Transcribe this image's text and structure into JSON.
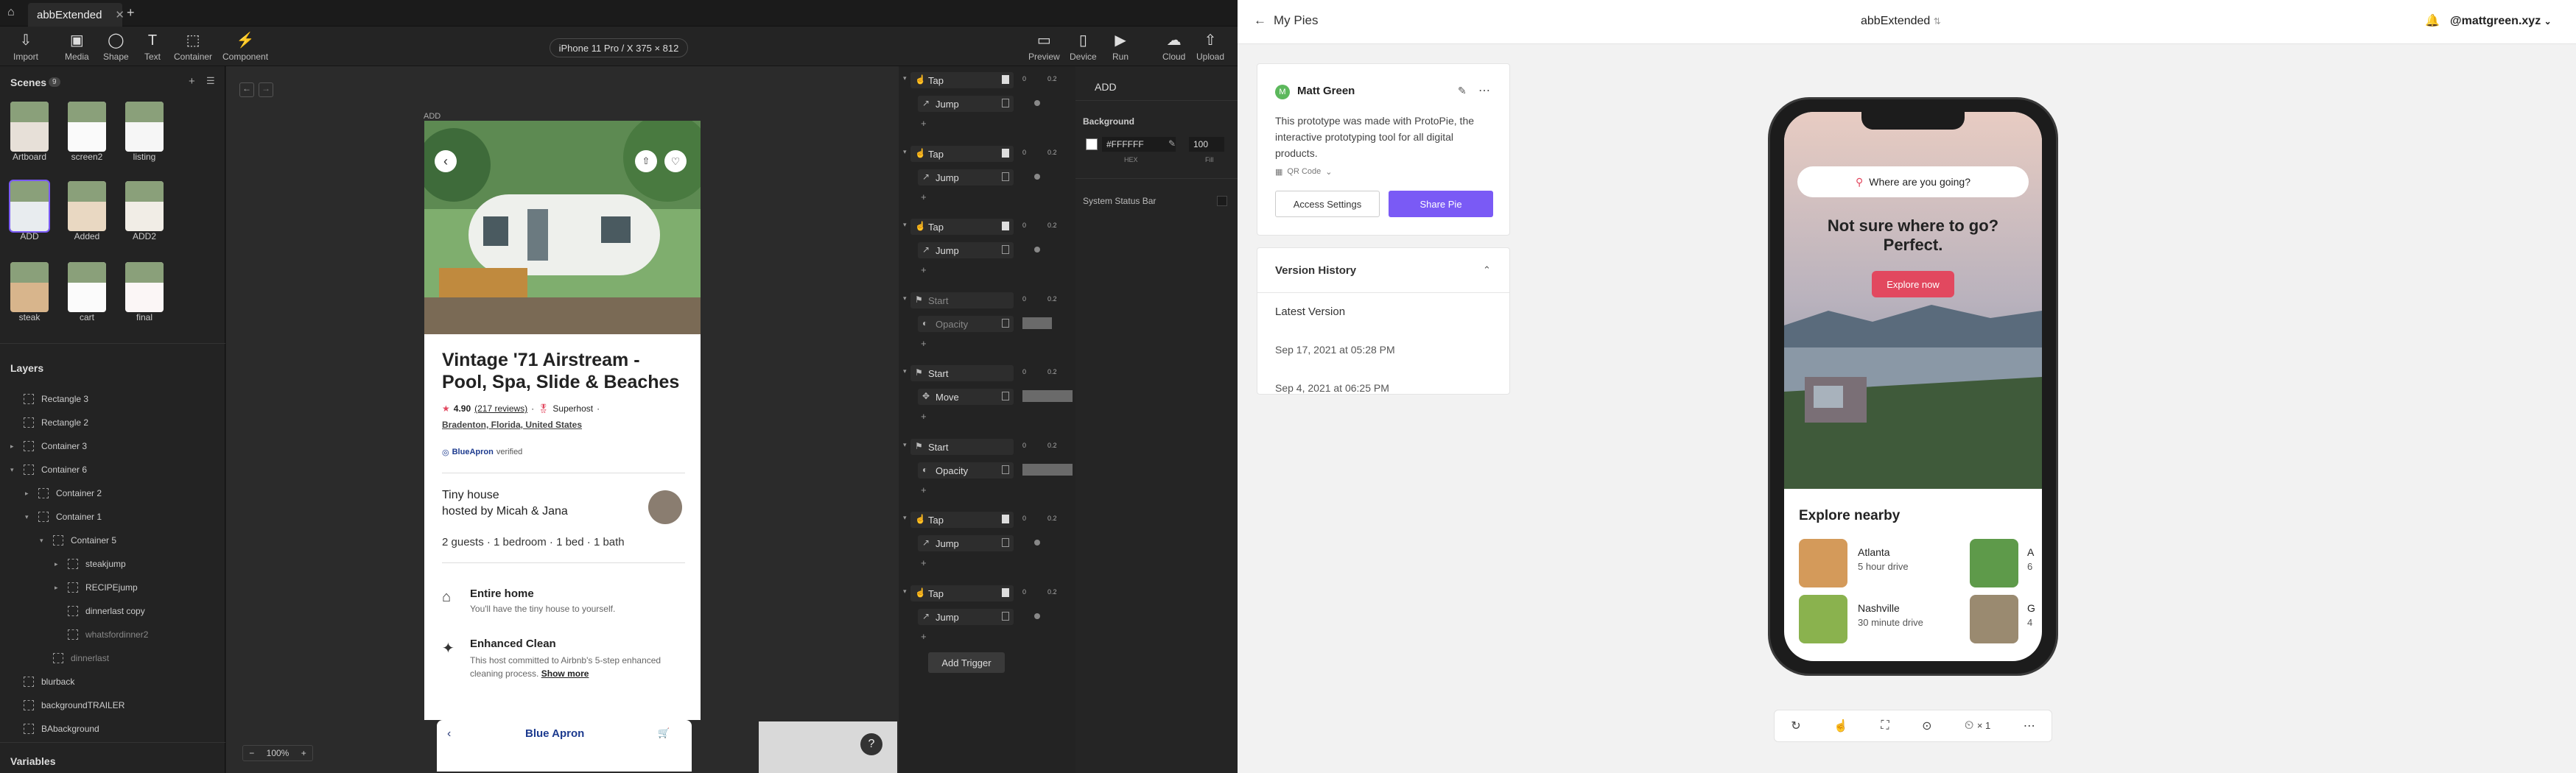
{
  "tabbar": {
    "home_icon": "home-icon",
    "tab_title": "abbExtended",
    "add_icon": "plus-icon"
  },
  "toolbar": {
    "import": "Import",
    "media": "Media",
    "shape": "Shape",
    "text": "Text",
    "container": "Container",
    "component": "Component",
    "device_selector": "iPhone 11 Pro / X  375 × 812",
    "preview": "Preview",
    "device": "Device",
    "run": "Run",
    "cloud": "Cloud",
    "upload": "Upload"
  },
  "scenes": {
    "title": "Scenes",
    "count": "9",
    "items": [
      "Artboard",
      "screen2",
      "listing",
      "ADD",
      "Added",
      "ADD2",
      "steak",
      "cart",
      "final"
    ]
  },
  "layers": {
    "title": "Layers",
    "items": [
      "Rectangle 3",
      "Rectangle 2",
      "Container 3",
      "Container 6",
      "Container 2",
      "Container 1",
      "Container 5",
      "steakjump",
      "RECIPEjump",
      "dinnerlast copy",
      "whatsfordinner2",
      "dinnerlast",
      "blurback",
      "backgroundTRAILER",
      "BAbackground"
    ]
  },
  "variables": "Variables",
  "canvas": {
    "scene_label": "ADD",
    "zoom": "100%",
    "help": "?"
  },
  "listing": {
    "title": "Vintage '71 Airstream - Pool, Spa, Slide & Beaches",
    "rating": "4.90",
    "reviews": "(217 reviews)",
    "dot1": "·",
    "superhost": "Superhost",
    "dot2": "·",
    "location": "Bradenton, Florida, United States",
    "brand": "BlueApron",
    "verified": "verified",
    "host_type": "Tiny house",
    "hosted_by": "hosted by Micah & Jana",
    "specs": "2 guests · 1 bedroom · 1 bed · 1 bath",
    "f1_title": "Entire home",
    "f1_desc": "You'll have the tiny house to yourself.",
    "f2_title": "Enhanced Clean",
    "f2_desc": "This host committed to Airbnb's 5-step enhanced cleaning process.",
    "show_more": "Show more",
    "overlay_brand": "Blue Apron"
  },
  "triggers": [
    {
      "type": "Tap",
      "action": "Jump"
    },
    {
      "type": "Tap",
      "action": "Jump"
    },
    {
      "type": "Tap",
      "action": "Jump"
    },
    {
      "type": "Start",
      "action": "Opacity"
    },
    {
      "type": "Start",
      "action": "Move"
    },
    {
      "type": "Start",
      "action": "Opacity"
    },
    {
      "type": "Tap",
      "action": "Jump"
    },
    {
      "type": "Tap",
      "action": "Jump"
    }
  ],
  "trigger_times": {
    "start": "0",
    "end": "0.2"
  },
  "add_trigger": "Add Trigger",
  "inspector": {
    "title": "ADD",
    "background": "Background",
    "hex": "#FFFFFF",
    "hex_label": "HEX",
    "fill": "100",
    "fill_label": "Fill",
    "status_bar": "System Status Bar"
  },
  "right": {
    "back": "My Pies",
    "title": "abbExtended",
    "user": "@mattgreen.xyz",
    "author": "Matt Green",
    "author_initial": "M",
    "description": "This prototype was made with ProtoPie, the interactive prototyping tool for all digital products.",
    "qr": "QR Code",
    "access": "Access Settings",
    "share": "Share Pie",
    "version_history": "Version History",
    "latest": "Latest Version",
    "v1": "Sep 17, 2021 at 05:28 PM",
    "v2": "Sep 4, 2021 at 06:25 PM",
    "zoom_level": "× 1"
  },
  "preview": {
    "search": "Where are you going?",
    "headline": "Not sure where to go? Perfect.",
    "explore": "Explore now",
    "nearby": "Explore nearby",
    "p1_city": "Atlanta",
    "p1_dist": "5 hour drive",
    "p2_city": "Nashville",
    "p2_dist": "30 minute drive",
    "p3_city": "A",
    "p3_dist": "6",
    "p4_city": "G",
    "p4_dist": "4"
  },
  "colors": {
    "accent": "#7a5af5",
    "airbnb": "#e2485f",
    "canvas": "#2b2b2b"
  }
}
